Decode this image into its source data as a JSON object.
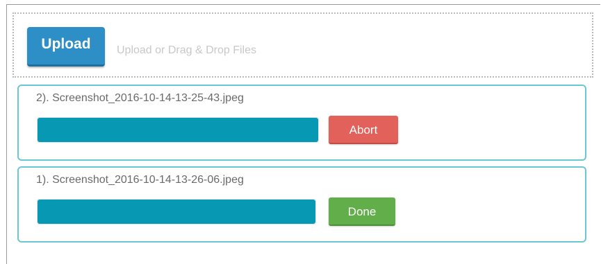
{
  "uploader": {
    "upload_button_label": "Upload",
    "dropzone_hint": "Upload or Drag & Drop Files",
    "files": [
      {
        "name": "2). Screenshot_2016-10-14-13-25-43.jpeg",
        "progress": 1.0,
        "action_label": "Abort",
        "action_color": "#e2625b"
      },
      {
        "name": "1). Screenshot_2016-10-14-13-26-06.jpeg",
        "progress": 1.0,
        "action_label": "Done",
        "action_color": "#62ae4a"
      }
    ]
  },
  "colors": {
    "upload_button": "#2d8fc6",
    "progress_fill": "#0799b4",
    "item_border": "#6cc7d3"
  }
}
